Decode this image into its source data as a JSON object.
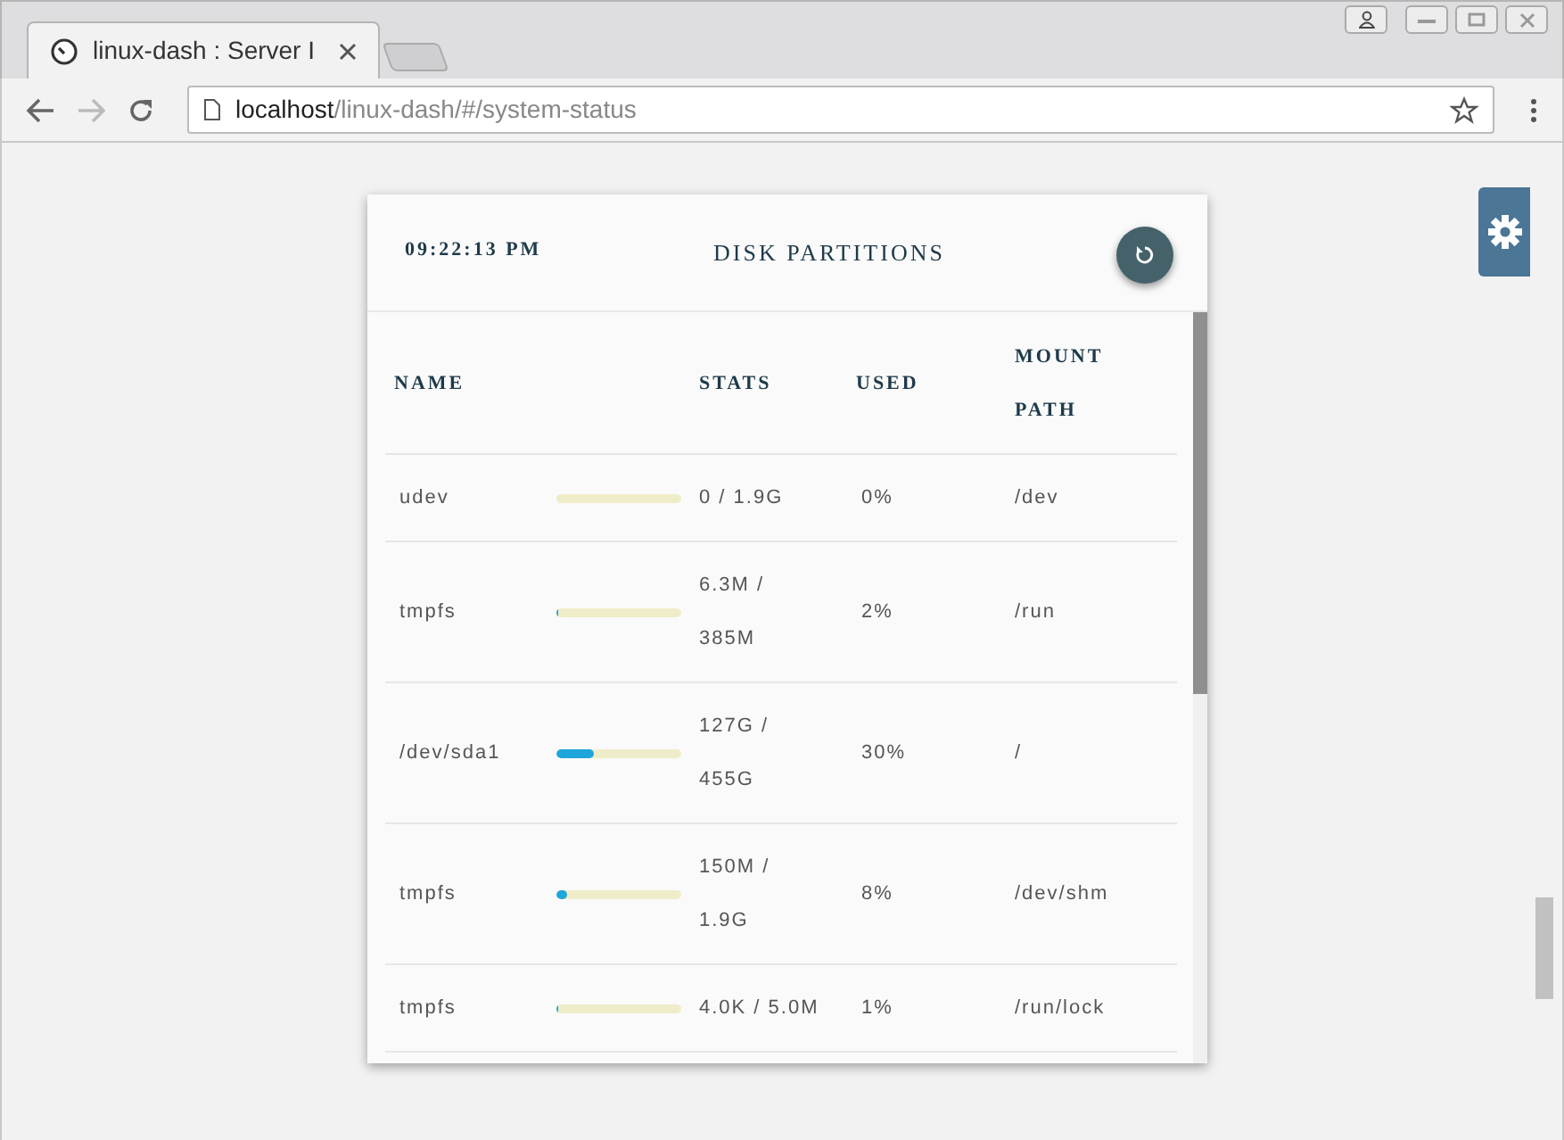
{
  "browser": {
    "tab_title": "linux-dash : Server I",
    "url_host": "localhost",
    "url_path": "/linux-dash/#/system-status"
  },
  "card": {
    "time": "09:22:13 PM",
    "title": "DISK PARTITIONS",
    "columns": [
      "NAME",
      "STATS",
      "USED",
      "MOUNT\nPATH"
    ],
    "rows": [
      {
        "name": "udev",
        "level": 0,
        "stats": "0 / 1.9G",
        "used": "0%",
        "mount": "/dev"
      },
      {
        "name": "tmpfs",
        "level": 0.02,
        "stats": "6.3M /\n385M",
        "used": "2%",
        "mount": "/run"
      },
      {
        "name": "/dev/sda1",
        "level": 0.3,
        "stats": "127G /\n455G",
        "used": "30%",
        "mount": "/"
      },
      {
        "name": "tmpfs",
        "level": 0.08,
        "stats": "150M /\n1.9G",
        "used": "8%",
        "mount": "/dev/shm"
      },
      {
        "name": "tmpfs",
        "level": 0.01,
        "stats": "4.0K / 5.0M",
        "used": "1%",
        "mount": "/run/lock"
      }
    ]
  }
}
